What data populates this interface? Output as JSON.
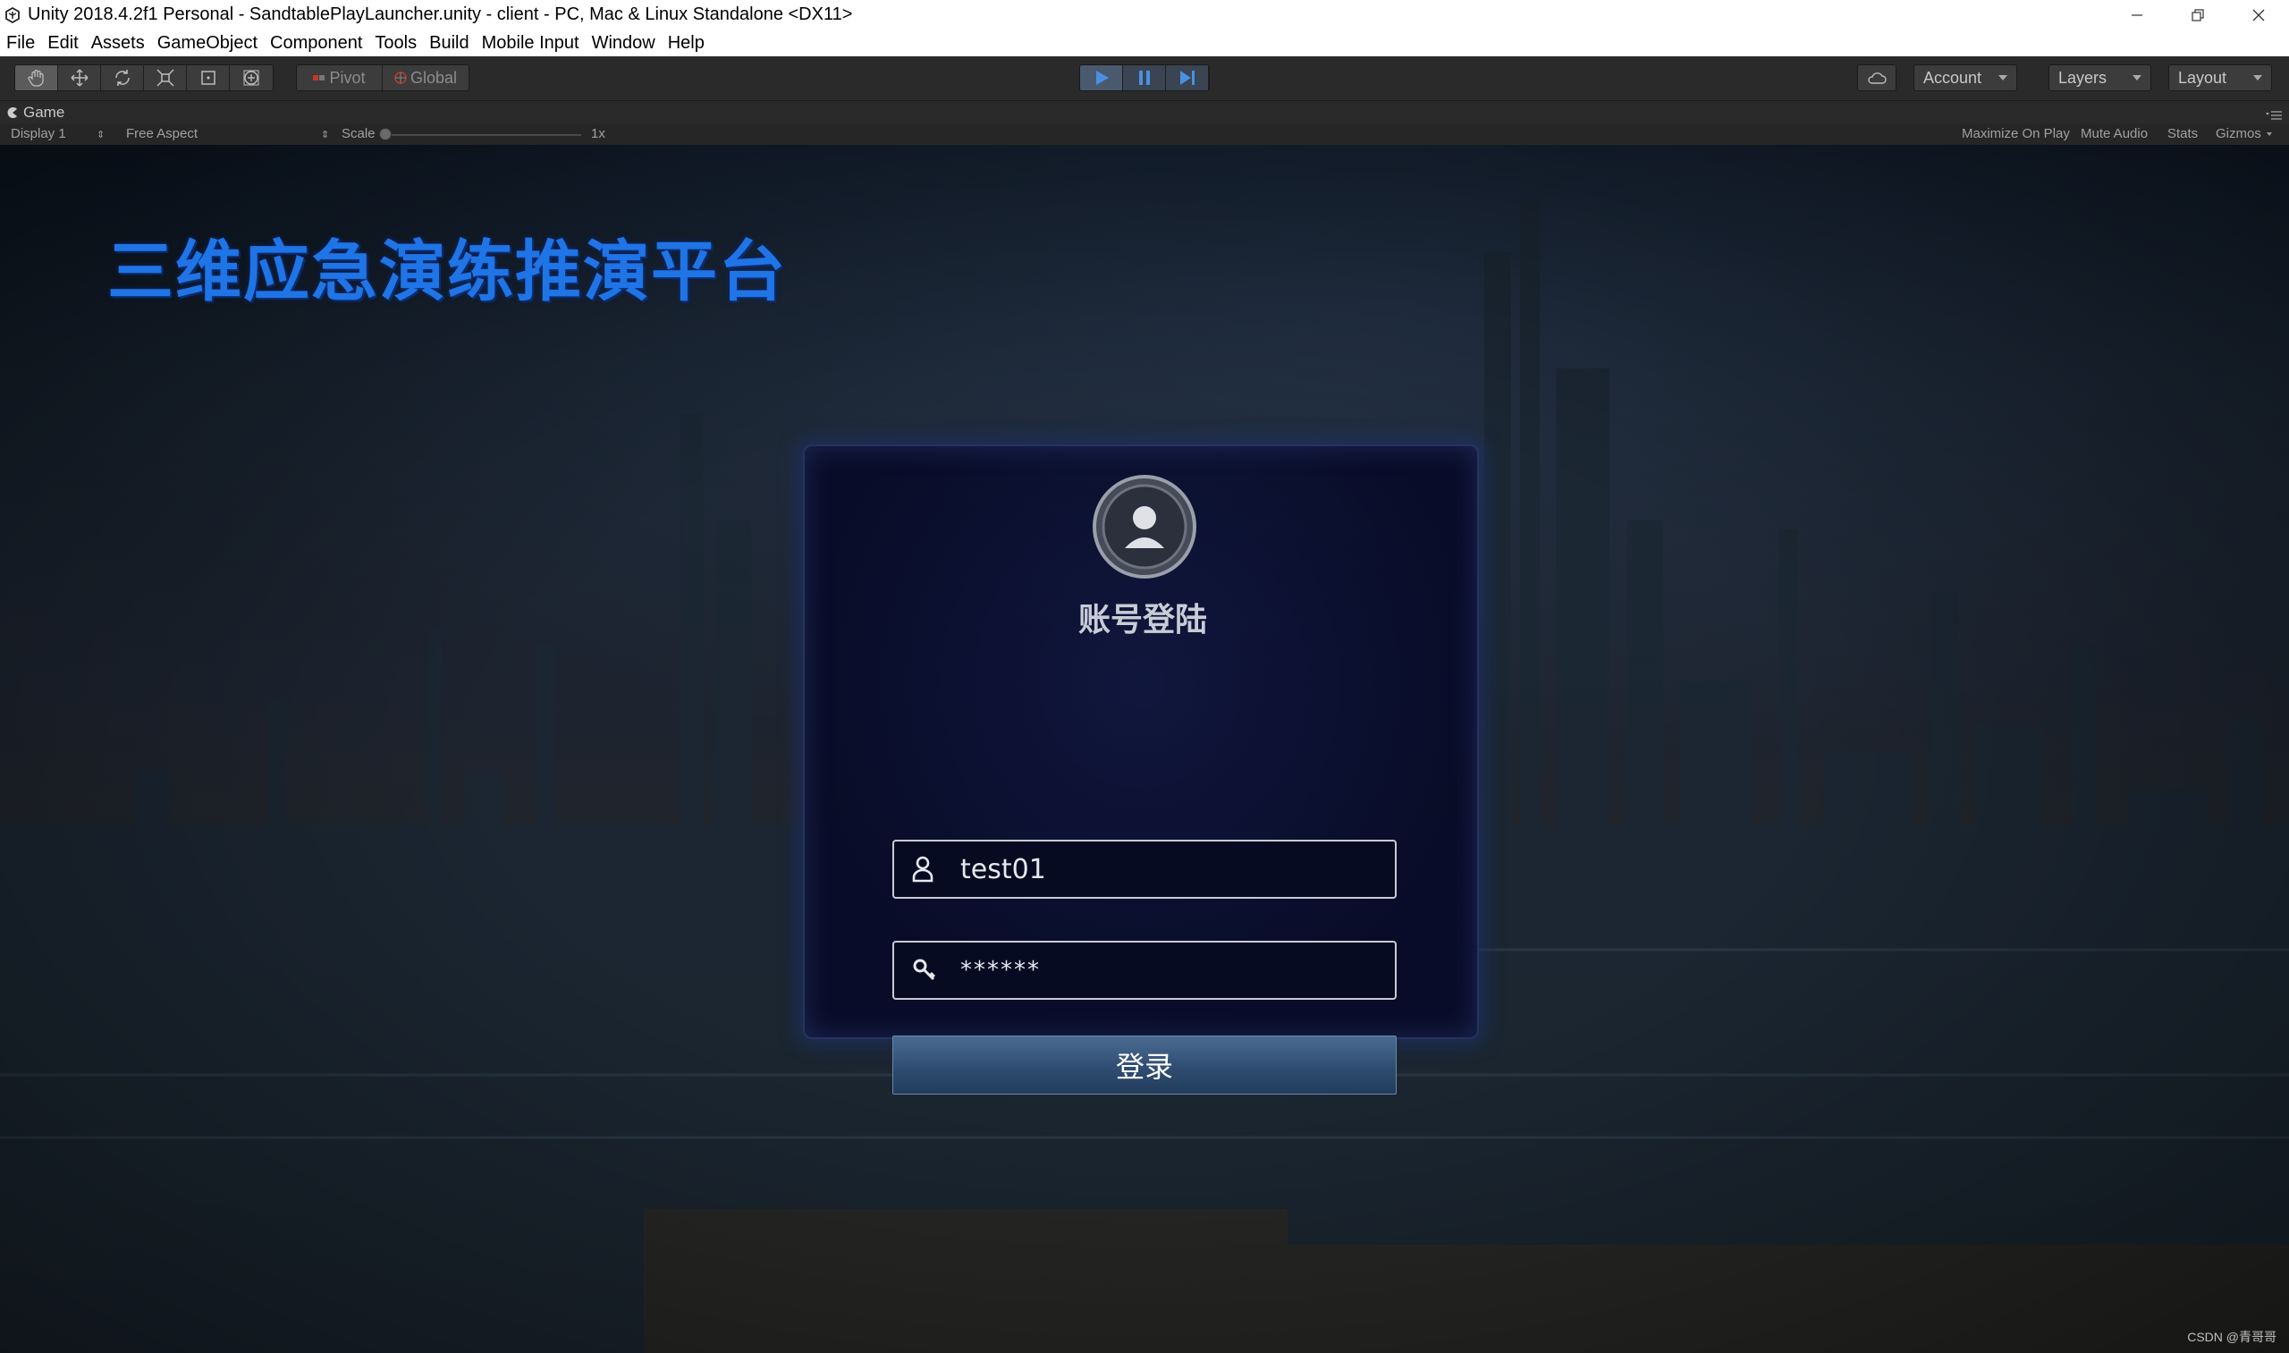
{
  "window": {
    "title": "Unity 2018.4.2f1 Personal - SandtablePlayLauncher.unity - client - PC, Mac & Linux Standalone <DX11>"
  },
  "menu": [
    "File",
    "Edit",
    "Assets",
    "GameObject",
    "Component",
    "Tools",
    "Build",
    "Mobile Input",
    "Window",
    "Help"
  ],
  "toolbar": {
    "pivot_label": "Pivot",
    "global_label": "Global",
    "account_label": "Account",
    "layers_label": "Layers",
    "layout_label": "Layout"
  },
  "game_view": {
    "tab_label": "Game",
    "display": "Display 1",
    "aspect": "Free Aspect",
    "scale_label": "Scale",
    "scale_value": "1x",
    "maximize_on_play": "Maximize On Play",
    "mute_audio": "Mute Audio",
    "stats": "Stats",
    "gizmos": "Gizmos"
  },
  "scene": {
    "platform_title": "三维应急演练推演平台",
    "login_title": "账号登陆",
    "username_value": "test01",
    "password_value": "******",
    "login_button": "登录"
  },
  "watermark": "CSDN @青哥哥",
  "colors": {
    "title_blue": "#1f74e6",
    "panel_bg": "#0a0f30",
    "button_blue": "#34547a",
    "play_active": "#4a90e2"
  }
}
